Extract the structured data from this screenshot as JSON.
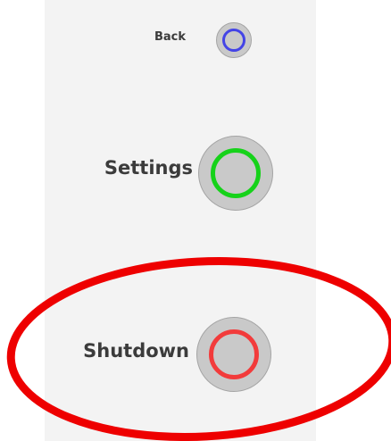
{
  "menu": {
    "back_label": "Back",
    "settings_label": "Settings",
    "shutdown_label": "Shutdown"
  },
  "colors": {
    "panel_background": "#f3f3f3",
    "button_fill": "#c9c9c9",
    "back_ring": "#4444e6",
    "settings_ring": "#16d21a",
    "shutdown_ring": "#f23b3b",
    "highlight_annotation": "#ee0000"
  },
  "icons": {
    "back": "blue-ring-icon",
    "settings": "green-ring-icon",
    "shutdown": "red-ring-icon"
  }
}
